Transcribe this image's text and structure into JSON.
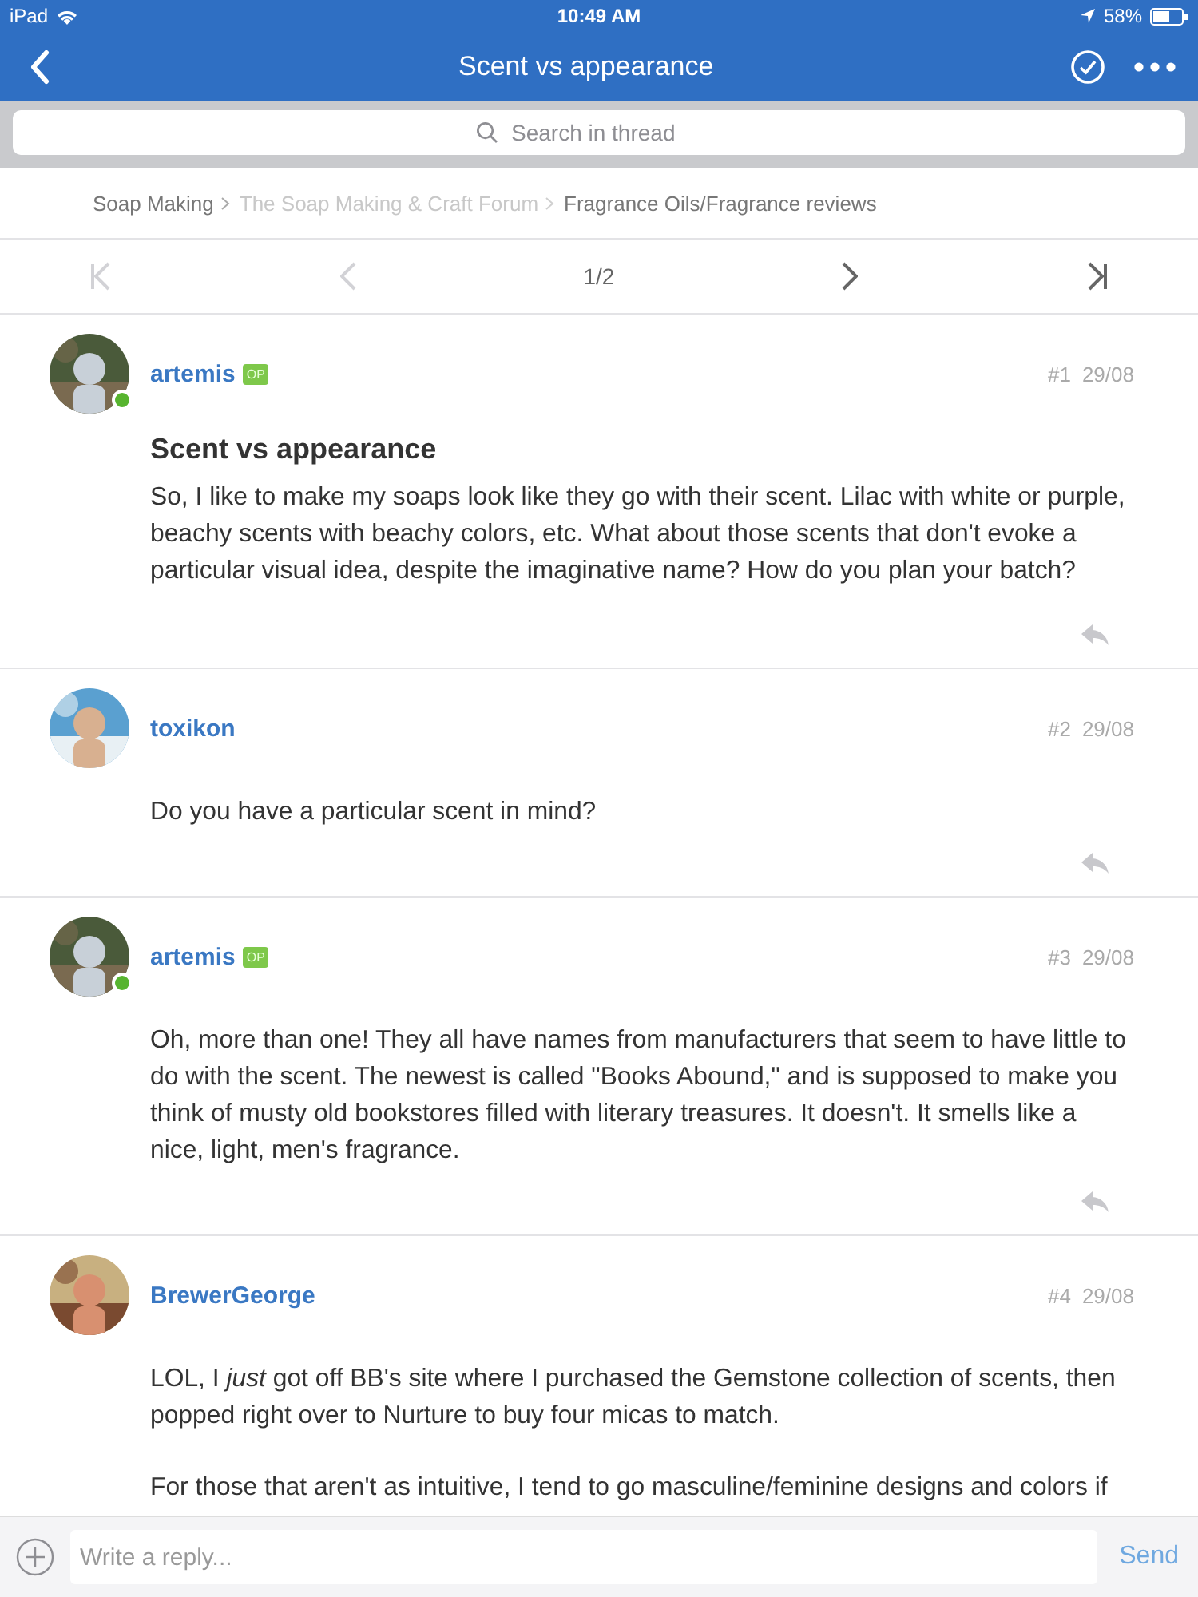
{
  "status_bar": {
    "device": "iPad",
    "time": "10:49 AM",
    "battery": "58%"
  },
  "nav": {
    "title": "Scent vs appearance"
  },
  "search": {
    "placeholder": "Search in thread"
  },
  "breadcrumb": [
    {
      "label": "Soap Making",
      "muted": false
    },
    {
      "label": "The Soap Making & Craft Forum",
      "muted": true
    },
    {
      "label": "Fragrance Oils/Fragrance reviews",
      "muted": false
    }
  ],
  "pager": {
    "page": "1/2",
    "first_disabled": true,
    "prev_disabled": true,
    "next_disabled": false,
    "last_disabled": false
  },
  "posts": [
    {
      "author": "artemis",
      "badge": "OP",
      "online": true,
      "number": "#1",
      "date": "29/08",
      "title": "Scent vs appearance",
      "paragraphs": [
        "So, I like to make my soaps look like they go with their scent. Lilac with white or purple, beachy scents with beachy colors, etc. What about those scents that don't evoke a particular visual idea, despite the imaginative name? How do you plan your batch?"
      ]
    },
    {
      "author": "toxikon",
      "online": false,
      "number": "#2",
      "date": "29/08",
      "paragraphs": [
        "Do you have a particular scent in mind?"
      ]
    },
    {
      "author": "artemis",
      "badge": "OP",
      "online": true,
      "number": "#3",
      "date": "29/08",
      "paragraphs": [
        "Oh, more than one! They all have names from manufacturers that seem to have little to do with the scent. The newest is called \"Books Abound,\" and is supposed to make you think of musty old bookstores filled with literary treasures. It doesn't. It smells like a nice, light, men's fragrance."
      ]
    },
    {
      "author": "BrewerGeorge",
      "online": false,
      "number": "#4",
      "date": "29/08",
      "paragraphs": [
        "LOL,  I *just* got off BB's site where I purchased the Gemstone collection of scents, then popped right over to Nurture to buy four micas to match.",
        "For those that aren't as intuitive, I tend to go masculine/feminine designs and colors if"
      ]
    }
  ],
  "composer": {
    "placeholder": "Write a reply...",
    "send": "Send"
  }
}
